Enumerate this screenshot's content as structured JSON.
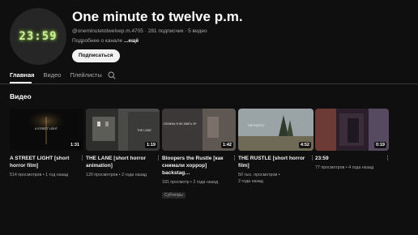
{
  "channel": {
    "avatar_text": "23:59",
    "name": "One minute to twelve p.m.",
    "handle": "@oneminutetotwelvep.m.4705",
    "subscribers": "281 подписчик",
    "video_count": "5 видео",
    "about_prefix": "Подробнее о канале",
    "about_more": "...ещё",
    "subscribe_label": "Подписаться"
  },
  "tabs": [
    {
      "label": "Главная",
      "active": true
    },
    {
      "label": "Видео",
      "active": false
    },
    {
      "label": "Плейлисты",
      "active": false
    }
  ],
  "section_title": "Видео",
  "videos": [
    {
      "title": "A STREET LIGHT [short horror film]",
      "duration": "1:31",
      "views": "514 просмотров",
      "age": "1 год назад",
      "thumb_text": "A STREET LIGHT"
    },
    {
      "title": "THE LANE [short horror animation]",
      "duration": "1:19",
      "views": "120 просмотров",
      "age": "2 года назад",
      "thumb_text": "THE LANE"
    },
    {
      "title": "Bloopers the Rustle [как снимали хоррор] backstag…",
      "duration": "1:42",
      "views": "181 просмотр",
      "age": "2 года назад",
      "badge": "Субтитры",
      "thumb_text": "СЛОЖНА Я НЕ ХВАТЬ ХР"
    },
    {
      "title": "THE RUSTLE [short horror film]",
      "duration": "4:52",
      "views": "50 тыс. просмотров",
      "age": "2 года назад",
      "thumb_text": "THE RUSTLE"
    },
    {
      "title": "23:59",
      "duration": "0:19",
      "views": "77 просмотров",
      "age": "4 года назад"
    }
  ]
}
